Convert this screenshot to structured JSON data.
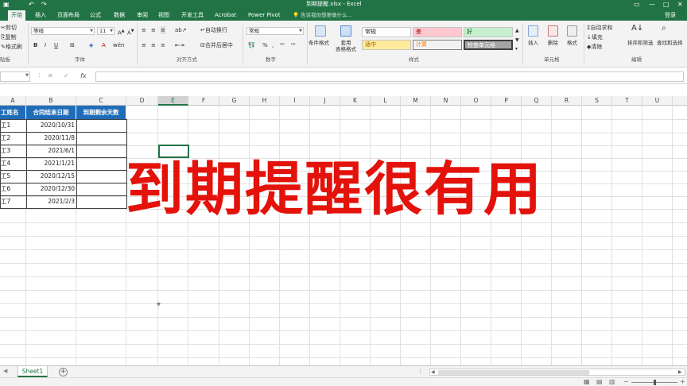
{
  "titlebar": {
    "title": "到期提醒.xlsx - Excel"
  },
  "tabs": [
    "开始",
    "插入",
    "页面布局",
    "公式",
    "数据",
    "审阅",
    "视图",
    "开发工具",
    "Acrobat",
    "Power Pivot"
  ],
  "tell_me": "告诉我你想要做什么...",
  "login": "登录",
  "ribbon": {
    "clipboard": {
      "cut": "剪切",
      "copy": "复制",
      "painter": "格式刷",
      "group": "贴板"
    },
    "font": {
      "name": "等线",
      "size": "11",
      "group": "字体"
    },
    "alignment": {
      "wrap": "自动换行",
      "merge": "合并后居中",
      "group": "对齐方式"
    },
    "number": {
      "format": "常规",
      "group": "数字"
    },
    "styles": {
      "conditional": "条件格式",
      "table": "套用\n表格格式",
      "cells": [
        "常规",
        "差",
        "好",
        "适中",
        "计算",
        "检查单元格"
      ],
      "group": "样式"
    },
    "cells_group": {
      "insert": "插入",
      "delete": "删除",
      "format": "格式",
      "group": "单元格"
    },
    "editing": {
      "autosum": "自动求和",
      "fill": "填充",
      "clear": "清除",
      "sort": "排序和筛选",
      "find": "查找和选择",
      "group": "编辑"
    }
  },
  "formula_bar": {
    "fx": "fx"
  },
  "columns": [
    "A",
    "B",
    "C",
    "D",
    "E",
    "F",
    "G",
    "H",
    "I",
    "J",
    "K",
    "L",
    "M",
    "N",
    "O",
    "P",
    "Q",
    "R",
    "S",
    "T",
    "U"
  ],
  "table": {
    "headers": [
      "工姓名",
      "合同结束日期",
      "到期剩余天数"
    ],
    "rows": [
      [
        "工1",
        "2020/10/31",
        ""
      ],
      [
        "工2",
        "2020/11/8",
        ""
      ],
      [
        "工3",
        "2021/6/1",
        ""
      ],
      [
        "工4",
        "2021/1/21",
        ""
      ],
      [
        "工5",
        "2020/12/15",
        ""
      ],
      [
        "工6",
        "2020/12/30",
        ""
      ],
      [
        "工7",
        "2021/2/3",
        ""
      ]
    ]
  },
  "overlay_text": "到期提醒很有用",
  "sheet_tab": "Sheet1",
  "colors": {
    "excel_green": "#217346",
    "header_blue": "#1f6cb8",
    "overlay_red": "#e3120b"
  }
}
